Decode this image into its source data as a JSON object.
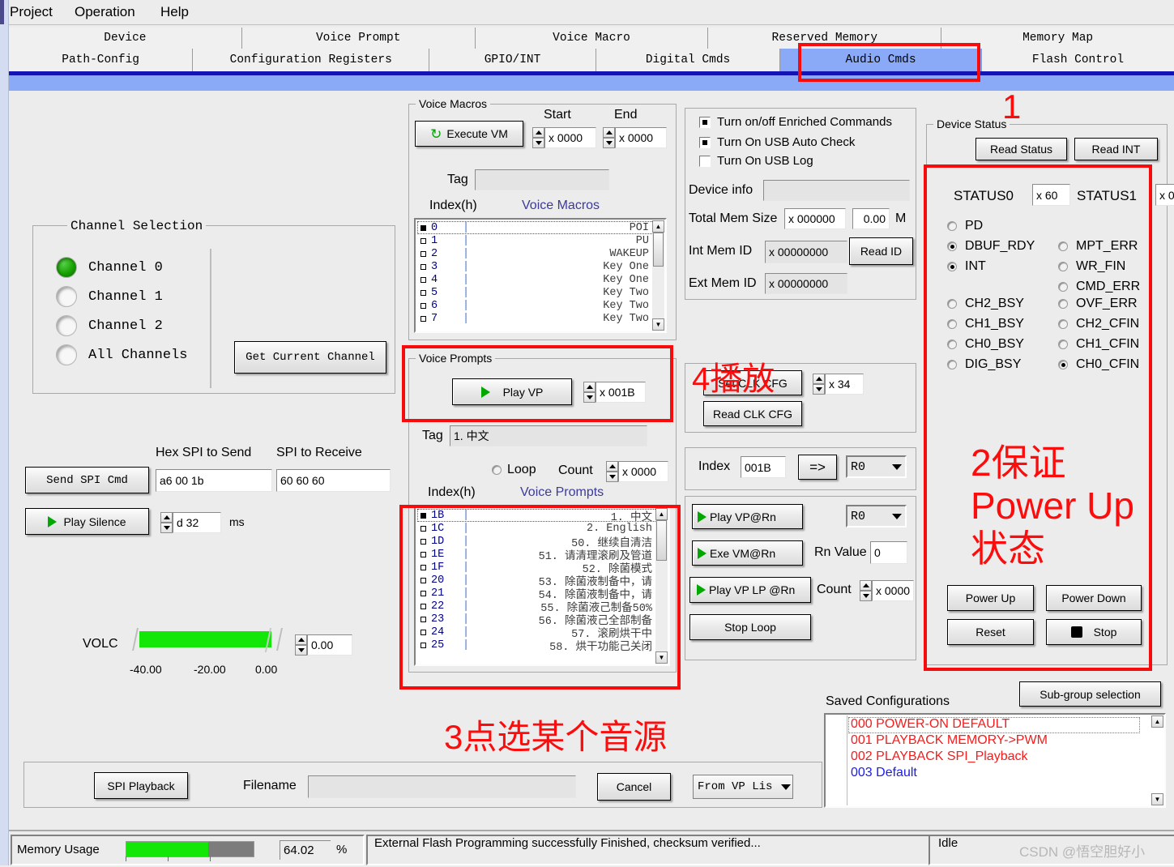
{
  "menu": {
    "items": [
      "Project",
      "Operation",
      "Help"
    ]
  },
  "tabs": {
    "row1": [
      "Device",
      "Voice Prompt",
      "Voice Macro",
      "Reserved Memory",
      "Memory Map"
    ],
    "row2": [
      "Path-Config",
      "Configuration Registers",
      "GPIO/INT",
      "Digital Cmds",
      "Audio Cmds",
      "Flash Control"
    ],
    "selected": "Audio Cmds"
  },
  "channel_selection": {
    "title": "Channel Selection",
    "options": [
      "Channel 0",
      "Channel 1",
      "Channel 2",
      "All Channels"
    ],
    "selected_index": 0,
    "get_current_channel": "Get Current Channel"
  },
  "spi": {
    "hex_to_send_label": "Hex SPI to Send",
    "to_receive_label": "SPI to Receive",
    "send_button": "Send SPI Cmd",
    "hex_to_send_value": "a6 00 1b",
    "to_receive_value": "60 60 60",
    "play_silence_button": "Play Silence",
    "silence_value": "d 32",
    "silence_unit": "ms"
  },
  "volume": {
    "label": "VOLC",
    "value": "0.00",
    "ticks": [
      "-40.00",
      "-20.00",
      "0.00"
    ],
    "fill_color": "#13e708",
    "fill_percent": 86
  },
  "voice_macros": {
    "title": "Voice Macros",
    "execute_button": "Execute VM",
    "start_label": "Start",
    "end_label": "End",
    "start_value": "x 0000",
    "end_value": "x 0000",
    "tag_label": "Tag",
    "tag_value": "",
    "index_header": "Index(h)",
    "list_header": "Voice Macros",
    "rows": [
      {
        "index": "0",
        "text": "POI",
        "selected": true
      },
      {
        "index": "1",
        "text": "PU",
        "selected": false
      },
      {
        "index": "2",
        "text": "WAKEUP",
        "selected": false
      },
      {
        "index": "3",
        "text": "Key One",
        "selected": false
      },
      {
        "index": "4",
        "text": "Key One",
        "selected": false
      },
      {
        "index": "5",
        "text": "Key Two",
        "selected": false
      },
      {
        "index": "6",
        "text": "Key Two",
        "selected": false
      },
      {
        "index": "7",
        "text": "Key Two",
        "selected": false
      }
    ]
  },
  "voice_prompts": {
    "title": "Voice Prompts",
    "play_button": "Play VP",
    "index_value": "x 001B",
    "tag_label": "Tag",
    "tag_value": "1. 中文",
    "loop_label": "Loop",
    "count_label": "Count",
    "count_value": "x 0000",
    "index_header": "Index(h)",
    "list_header": "Voice Prompts",
    "rows": [
      {
        "index": "1B",
        "text": "1. 中文",
        "selected": true
      },
      {
        "index": "1C",
        "text": "2. English",
        "selected": false
      },
      {
        "index": "1D",
        "text": "50. 继续自清洁",
        "selected": false
      },
      {
        "index": "1E",
        "text": "51. 请清理滚刷及管道",
        "selected": false
      },
      {
        "index": "1F",
        "text": "52. 除菌模式",
        "selected": false
      },
      {
        "index": "20",
        "text": "53. 除菌液制备中，请",
        "selected": false
      },
      {
        "index": "21",
        "text": "54. 除菌液制备中，请",
        "selected": false
      },
      {
        "index": "22",
        "text": "55. 除菌液己制备50%",
        "selected": false
      },
      {
        "index": "23",
        "text": "56. 除菌液己全部制备",
        "selected": false
      },
      {
        "index": "24",
        "text": "57. 滚刷烘干中",
        "selected": false
      },
      {
        "index": "25",
        "text": "58. 烘干功能己关闭",
        "selected": false
      }
    ]
  },
  "device_options": {
    "checkboxes": [
      {
        "label": "Turn on/off Enriched Commands",
        "checked": true
      },
      {
        "label": "Turn On USB Auto Check",
        "checked": true
      },
      {
        "label": "Turn On USB Log",
        "checked": false
      }
    ],
    "device_info_label": "Device info",
    "device_info_value": "",
    "total_mem_label": "Total Mem Size",
    "total_mem_value": "x 000000",
    "total_mem_mb": "0.00",
    "total_mem_unit": "M",
    "int_mem_label": "Int Mem ID",
    "int_mem_value": "x 00000000",
    "read_id_button": "Read ID",
    "ext_mem_label": "Ext Mem ID",
    "ext_mem_value": "x 00000000"
  },
  "clk": {
    "set_button": "Set CLK CFG",
    "read_button": "Read CLK CFG",
    "value": "x 34"
  },
  "rn_panel": {
    "index_label": "Index",
    "index_value": "001B",
    "arrow_button": "=>",
    "register_select_top": "R0",
    "register_select_mid": "R0",
    "play_vp_rn": "Play VP@Rn",
    "exe_vm_rn": "Exe VM@Rn",
    "rn_value_label": "Rn Value",
    "rn_value": "0",
    "play_vp_lp_rn": "Play VP LP @Rn",
    "count_label": "Count",
    "count_value": "x 0000",
    "stop_loop": "Stop Loop"
  },
  "device_status": {
    "title": "Device Status",
    "read_status_button": "Read Status",
    "read_int_button": "Read INT",
    "status0_label": "STATUS0",
    "status0_value": "x 60",
    "status1_label": "STATUS1",
    "status1_value": "x 0",
    "left_flags": [
      {
        "label": "PD",
        "on": false
      },
      {
        "label": "DBUF_RDY",
        "on": true
      },
      {
        "label": "INT",
        "on": true
      },
      {
        "label": "CH2_BSY",
        "on": false
      },
      {
        "label": "CH1_BSY",
        "on": false
      },
      {
        "label": "CH0_BSY",
        "on": false
      },
      {
        "label": "DIG_BSY",
        "on": false
      }
    ],
    "right_flags": [
      {
        "label": "MPT_ERR",
        "on": false
      },
      {
        "label": "WR_FIN",
        "on": false
      },
      {
        "label": "CMD_ERR",
        "on": false
      },
      {
        "label": "OVF_ERR",
        "on": false
      },
      {
        "label": "CH2_CFIN",
        "on": false
      },
      {
        "label": "CH1_CFIN",
        "on": false
      },
      {
        "label": "CH0_CFIN",
        "on": true
      }
    ],
    "power_up": "Power Up",
    "power_down": "Power Down",
    "reset": "Reset",
    "stop": "Stop"
  },
  "saved_configs": {
    "title": "Saved  Configurations",
    "subgroup_button": "Sub-group selection",
    "rows": [
      {
        "text": "000 POWER-ON DEFAULT",
        "color": "#f41c1c",
        "selected": true
      },
      {
        "text": "001 PLAYBACK MEMORY->PWM",
        "color": "#f41c1c",
        "selected": false
      },
      {
        "text": "002 PLAYBACK SPI_Playback",
        "color": "#f41c1c",
        "selected": false
      },
      {
        "text": "003 Default",
        "color": "#1b1bef",
        "selected": false
      }
    ]
  },
  "playback_bar": {
    "spi_playback_button": "SPI Playback",
    "filename_label": "Filename",
    "filename_value": "",
    "cancel_button": "Cancel",
    "source_select": "From VP Lis"
  },
  "status_bar": {
    "memory_usage_label": "Memory Usage",
    "memory_usage_percent": "64.02",
    "percent_sign": "%",
    "memory_fill": 64.02,
    "message": "External Flash Programming successfully Finished, checksum verified...",
    "state": "Idle",
    "watermark": "CSDN @悟空胆好小"
  },
  "annotations": {
    "a1": "1",
    "a2": "2保证\nPower Up\n状态",
    "a3": "3点选某个音源",
    "a4": "4播放"
  }
}
